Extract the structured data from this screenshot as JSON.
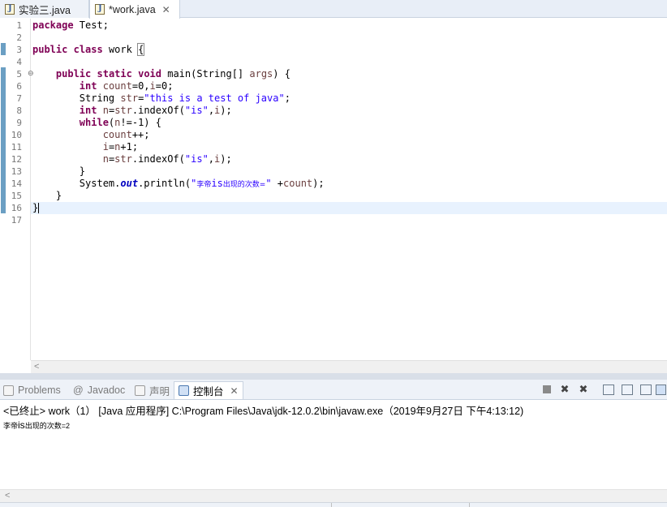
{
  "editor_tabs": [
    {
      "label": "实验三.java",
      "active": false
    },
    {
      "label": "*work.java",
      "active": true,
      "close": "✕"
    }
  ],
  "line_numbers": [
    "1",
    "2",
    "3",
    "4",
    "5",
    "6",
    "7",
    "8",
    "9",
    "10",
    "11",
    "12",
    "13",
    "14",
    "15",
    "16",
    "17"
  ],
  "code": {
    "l1_kw": "package",
    "l1_rest": " Test;",
    "l3_kw1": "public",
    "l3_kw2": "class",
    "l3_name": " work ",
    "l3_brace": "{",
    "l5_indent": "    ",
    "l5_kw1": "public",
    "l5_kw2": "static",
    "l5_kw3": "void",
    "l5_rest": " main(String[] ",
    "l5_var": "args",
    "l5_end": ") {",
    "l6_indent": "        ",
    "l6_kw": "int",
    "l6_sp": " ",
    "l6_var1": "count",
    "l6_mid": "=0,",
    "l6_var2": "i",
    "l6_end": "=0;",
    "l7_indent": "        ",
    "l7_type": "String ",
    "l7_var": "str",
    "l7_eq": "=",
    "l7_str": "\"this is a test of java\"",
    "l7_end": ";",
    "l8_indent": "        ",
    "l8_kw": "int",
    "l8_sp": " ",
    "l8_var": "n",
    "l8_mid": "=",
    "l8_var2": "str",
    "l8_call": ".indexOf(",
    "l8_str": "\"is\"",
    "l8_comma": ",",
    "l8_var3": "i",
    "l8_end": ");",
    "l9_indent": "        ",
    "l9_kw": "while",
    "l9_open": "(",
    "l9_var": "n",
    "l9_end": "!=-1) {",
    "l10_indent": "            ",
    "l10_var": "count",
    "l10_end": "++;",
    "l11_indent": "            ",
    "l11_var": "i",
    "l11_mid": "=",
    "l11_var2": "n",
    "l11_end": "+1;",
    "l12_indent": "            ",
    "l12_var": "n",
    "l12_mid": "=",
    "l12_var2": "str",
    "l12_call": ".indexOf(",
    "l12_str": "\"is\"",
    "l12_comma": ",",
    "l12_var3": "i",
    "l12_end": ");",
    "l13_indent": "        ",
    "l13_end": "}",
    "l14_indent": "        ",
    "l14_a": "System.",
    "l14_fld": "out",
    "l14_b": ".println(",
    "l14_q1": "\"",
    "l14_cn1": "李帝",
    "l14_is": "is",
    "l14_cn2": "出现的次数=",
    "l14_q2": "\"",
    "l14_c": " +",
    "l14_var": "count",
    "l14_end": ");",
    "l15_indent": "    ",
    "l15_end": "}",
    "l16_end": "}"
  },
  "view_tabs": [
    {
      "label": "Problems",
      "icon": "problems-icon"
    },
    {
      "label": "Javadoc",
      "icon": "javadoc-icon",
      "prefix": "@"
    },
    {
      "label": "声明",
      "icon": "declaration-icon"
    },
    {
      "label": "控制台",
      "icon": "console-icon",
      "active": true,
      "close": "✕"
    }
  ],
  "console": {
    "header": "<已终止> work（1） [Java 应用程序] C:\\Program Files\\Java\\jdk-12.0.2\\bin\\javaw.exe（2019年9月27日 下午4:13:12)",
    "out_cn1": "李帝",
    "out_is": "is",
    "out_cn2": "出现的次数=2"
  },
  "scroll_arrow": "<"
}
